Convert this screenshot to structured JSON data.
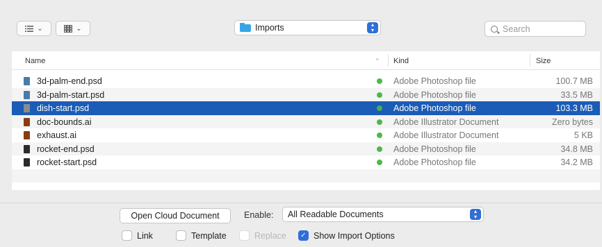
{
  "toolbar": {
    "list_view_icon": "list-view-icon",
    "grid_view_icon": "grid-view-icon",
    "location": "Imports",
    "search_placeholder": "Search"
  },
  "columns": {
    "name": "Name",
    "kind": "Kind",
    "size": "Size"
  },
  "files": [
    {
      "name": "3d-palm-end.psd",
      "kind": "Adobe Photoshop file",
      "size": "100.7 MB",
      "icon_color": "#4a7ba8"
    },
    {
      "name": "3d-palm-start.psd",
      "kind": "Adobe Photoshop file",
      "size": "33.5 MB",
      "icon_color": "#4a7ba8"
    },
    {
      "name": "dish-start.psd",
      "kind": "Adobe Photoshop file",
      "size": "103.3 MB",
      "icon_color": "#8a8a8a"
    },
    {
      "name": "doc-bounds.ai",
      "kind": "Adobe Illustrator Document",
      "size": "Zero bytes",
      "icon_color": "#8a3c12"
    },
    {
      "name": "exhaust.ai",
      "kind": "Adobe Illustrator Document",
      "size": "5 KB",
      "icon_color": "#8a3c12"
    },
    {
      "name": "rocket-end.psd",
      "kind": "Adobe Photoshop file",
      "size": "34.8 MB",
      "icon_color": "#2b2b2b"
    },
    {
      "name": "rocket-start.psd",
      "kind": "Adobe Photoshop file",
      "size": "34.2 MB",
      "icon_color": "#2b2b2b"
    }
  ],
  "selected_file": "dish-start.psd",
  "footer": {
    "open_cloud": "Open Cloud Document",
    "enable_label": "Enable:",
    "enable_value": "All Readable Documents",
    "link": "Link",
    "template": "Template",
    "replace": "Replace",
    "show_import_options": "Show Import Options"
  },
  "colors": {
    "accent": "#2f6fd6",
    "selection": "#1b5cb6",
    "status_dot": "#4fb84a"
  }
}
